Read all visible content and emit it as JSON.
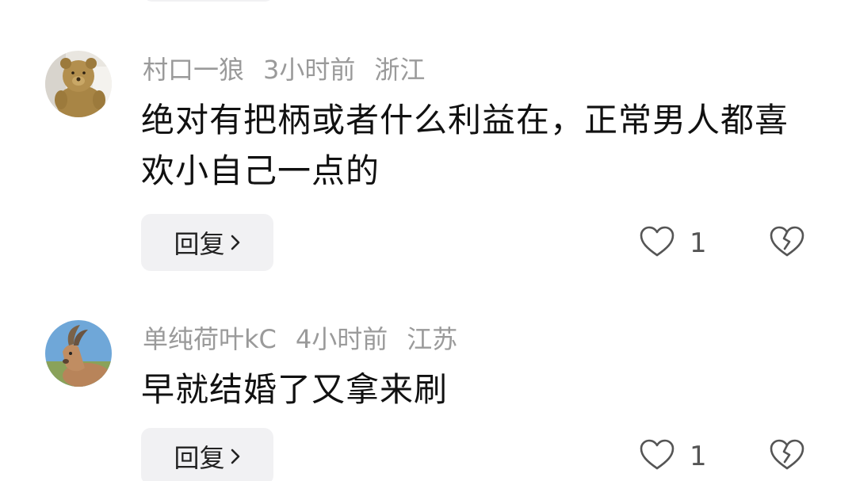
{
  "comments": [
    {
      "username": "村口一狼",
      "time": "3小时前",
      "location": "浙江",
      "text": "绝对有把柄或者什么利益在，正常男人都喜欢小自己一点的",
      "reply_label": "回复",
      "like_count": "1",
      "avatar_icon": "teddy-bear-avatar"
    },
    {
      "username": "单纯荷叶kC",
      "time": "4小时前",
      "location": "江苏",
      "text": "早就结婚了又拿来刷",
      "reply_label": "回复",
      "like_count": "1",
      "avatar_icon": "ibex-avatar"
    }
  ],
  "icons": {
    "like": "heart-outline-icon",
    "dislike": "broken-heart-icon",
    "reply_chevron": "chevron-right-icon"
  },
  "colors": {
    "meta_text": "#9a9a9a",
    "button_bg": "#f1f1f3",
    "icon_stroke": "#555555"
  }
}
